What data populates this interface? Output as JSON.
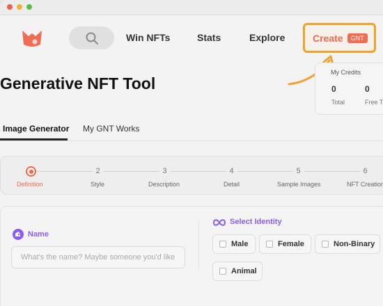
{
  "nav": {
    "links": [
      "Win NFTs",
      "Stats",
      "Explore"
    ],
    "create_label": "Create",
    "create_badge": "GNT"
  },
  "page": {
    "title": "Generative NFT Tool"
  },
  "credits": {
    "title": "My Credits",
    "items": [
      {
        "value": "0",
        "label": "Total"
      },
      {
        "value": "0",
        "label": "Free Ti"
      }
    ]
  },
  "tabs": [
    "Image Generator",
    "My GNT Works"
  ],
  "active_tab": "Image Generator",
  "steps": [
    {
      "number": "1",
      "label": "Definition",
      "active": true
    },
    {
      "number": "2",
      "label": "Style",
      "active": false
    },
    {
      "number": "3",
      "label": "Description",
      "active": false
    },
    {
      "number": "4",
      "label": "Detail",
      "active": false
    },
    {
      "number": "5",
      "label": "Sample Images",
      "active": false
    },
    {
      "number": "6",
      "label": "NFT Creation",
      "active": false
    }
  ],
  "form": {
    "name_label": "Name",
    "name_placeholder": "What's the name? Maybe someone you'd like",
    "identity_label": "Select Identity",
    "identities": [
      "Male",
      "Female",
      "Non-Binary",
      "Animal"
    ]
  },
  "colors": {
    "accent": "#ee6a4f",
    "highlight": "#f2a22c",
    "purple": "#8a5cf0"
  }
}
